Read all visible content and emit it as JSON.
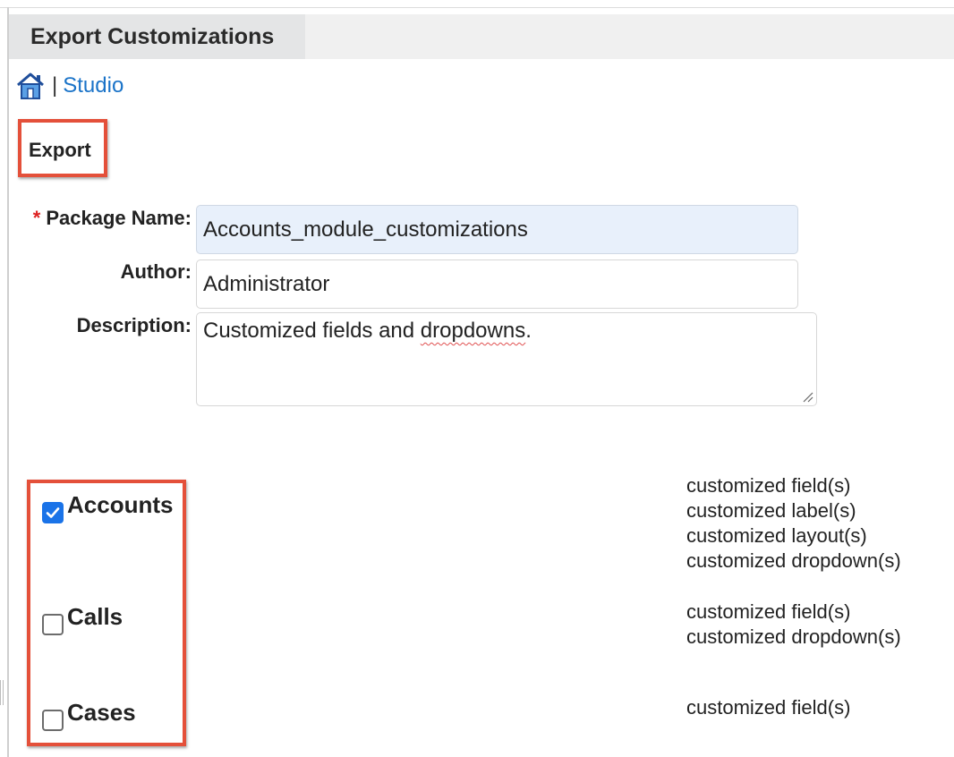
{
  "header": {
    "title": "Export Customizations"
  },
  "breadcrumb": {
    "home_icon": "home-icon",
    "separator": "|",
    "studio_link": "Studio"
  },
  "section": {
    "title": "Export"
  },
  "form": {
    "package_name": {
      "label": "Package Name:",
      "value": "Accounts_module_customizations",
      "required_marker": "*"
    },
    "author": {
      "label": "Author:",
      "value": "Administrator"
    },
    "description": {
      "label": "Description:",
      "value_plain": "Customized fields and ",
      "value_misspelled": "dropdowns",
      "value_end": "."
    }
  },
  "modules": [
    {
      "name": "Accounts",
      "checked": true,
      "customizations": [
        "customized field(s)",
        "customized label(s)",
        "customized layout(s)",
        "customized dropdown(s)"
      ]
    },
    {
      "name": "Calls",
      "checked": false,
      "customizations": [
        "customized field(s)",
        "customized dropdown(s)"
      ]
    },
    {
      "name": "Cases",
      "checked": false,
      "customizations": [
        "customized field(s)"
      ]
    }
  ],
  "colors": {
    "accent": "#1a73e8",
    "link": "#1a73c8",
    "highlight_border": "#e4503a",
    "required": "#dd2222"
  }
}
